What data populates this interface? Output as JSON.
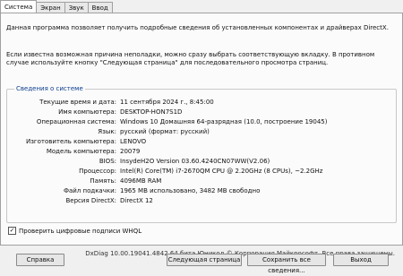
{
  "tabs": [
    "Система",
    "Экран",
    "Звук",
    "Ввод"
  ],
  "intro": "Данная программа позволяет получить подробные сведения об установленных компонентах и драйверах DirectX.",
  "intro2": "Если известна возможная причина неполадки, можно сразу выбрать соответствующую вкладку. В противном случае используйте кнопку \"Следующая страница\" для последовательного просмотра страниц.",
  "group_title": "Сведения о системе",
  "info": [
    {
      "label": "Текущие время и дата:",
      "value": "11 сентября 2024 г., 8:45:00"
    },
    {
      "label": "Имя компьютера:",
      "value": "DESKTOP-HON7S1D"
    },
    {
      "label": "Операционная система:",
      "value": "Windows 10 Домашняя 64-разрядная (10.0, построение 19045)"
    },
    {
      "label": "Язык:",
      "value": "русский (формат: русский)"
    },
    {
      "label": "Изготовитель компьютера:",
      "value": "LENOVO"
    },
    {
      "label": "Модель компьютера:",
      "value": "20079"
    },
    {
      "label": "BIOS:",
      "value": "InsydeH2O Version 03.60.4240CN07WW(V2.06)"
    },
    {
      "label": "Процессор:",
      "value": "Intel(R) Core(TM) i7-2670QM CPU @ 2.20GHz (8 CPUs), ~2.2GHz"
    },
    {
      "label": "Память:",
      "value": "4096MB RAM"
    },
    {
      "label": "Файл подкачки:",
      "value": "1965 МВ использовано, 3482 МВ свободно"
    },
    {
      "label": "Версия DirectX:",
      "value": "DirectX 12"
    }
  ],
  "whql_label": "Проверить цифровые подписи WHQL",
  "whql_checked": true,
  "footer": "DxDiag 10.00.19041.4842 64 бита Юникод © Корпорация Майкрософт. Все права защищены.",
  "buttons": {
    "help": "Справка",
    "next": "Следующая страница",
    "save": "Сохранить все сведения...",
    "exit": "Выход"
  }
}
